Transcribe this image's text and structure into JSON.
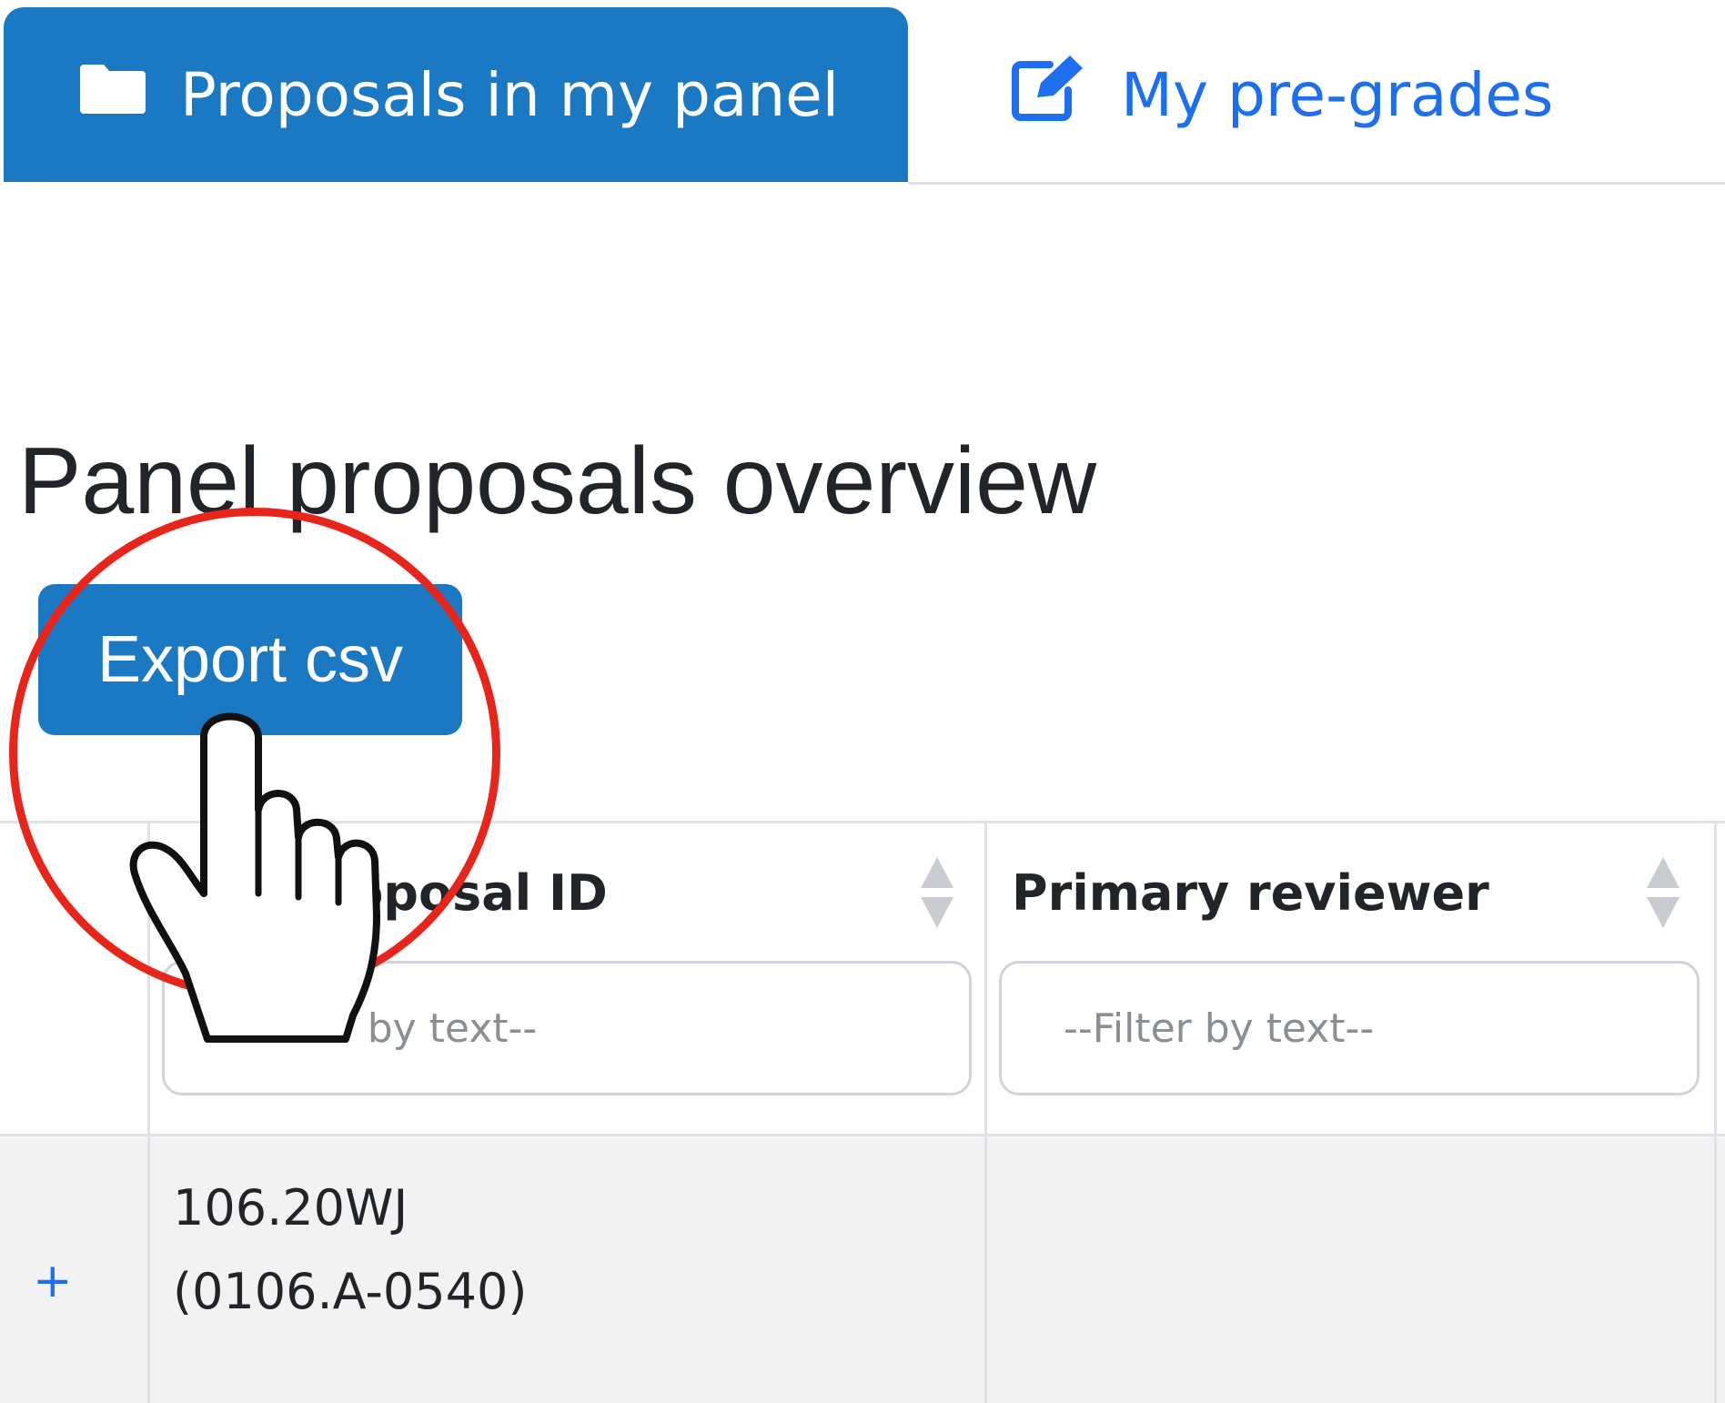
{
  "tabs": [
    {
      "label": "Proposals in my panel",
      "icon": "folder-icon",
      "active": true
    },
    {
      "label": "My pre-grades",
      "icon": "edit-icon",
      "active": false
    }
  ],
  "page_title": "Panel proposals overview",
  "export_button": {
    "label": "Export csv"
  },
  "table": {
    "columns": [
      {
        "label": "Proposal ID",
        "filter_placeholder": "--Filter by text--"
      },
      {
        "label": "Primary reviewer",
        "filter_placeholder": "--Filter by text--"
      }
    ],
    "rows": [
      {
        "expand_symbol": "+",
        "proposal_id_line1": "106.20WJ",
        "proposal_id_line2": "(0106.A-0540)",
        "primary_reviewer": ""
      }
    ]
  },
  "colors": {
    "primary": "#1b78c2",
    "link": "#1e6ff0",
    "highlight": "#e8251b",
    "row_bg": "#f2f2f2",
    "border": "#dee2e6"
  },
  "overlay": {
    "cursor_icon": "hand-pointer-icon",
    "highlight_icon": "red-circle-highlight"
  }
}
